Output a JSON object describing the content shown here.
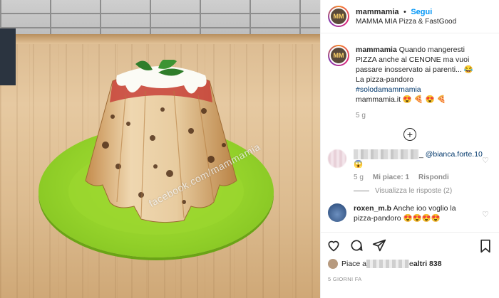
{
  "photo": {
    "watermark": "facebook.com/mammamia"
  },
  "header": {
    "username": "mammamia",
    "separator": "•",
    "follow_label": "Segui",
    "subtitle": "MAMMA MIA Pizza & FastGood"
  },
  "caption": {
    "username": "mammamia",
    "line1": " Quando mangeresti",
    "line2": "PIZZA anche al CENONE ma vuoi",
    "line3": "passare inosservato ai parenti... 😂",
    "line4": "La pizza-pandoro",
    "hashtag": "#solodamammamia",
    "line6": "mammamia.it 😍 🍕 😍 🍕",
    "time": "5 g"
  },
  "comments": [
    {
      "suffix": "_",
      "mention": "@bianca.forte.10",
      "emoji": "😱",
      "time": "5 g",
      "likes": "Mi piace: 1",
      "reply_label": "Rispondi",
      "view_replies": "Visualizza le risposte (2)"
    },
    {
      "username": "roxen_m.b",
      "text": " Anche ioo voglio la",
      "text2": "pizza-pandoro 😍😍😍😍"
    }
  ],
  "likes": {
    "prefix": "Piace a ",
    "suffix_and": " e ",
    "others": "altri 838"
  },
  "timestamp": "5 GIORNI FA",
  "icons": {
    "like": "heart-icon",
    "comment": "comment-icon",
    "share": "share-icon",
    "save": "bookmark-icon",
    "load_more": "plus-circle-icon"
  },
  "colors": {
    "link_blue": "#0095f6",
    "hashtag": "#00376b",
    "muted": "#8e8e8e"
  }
}
